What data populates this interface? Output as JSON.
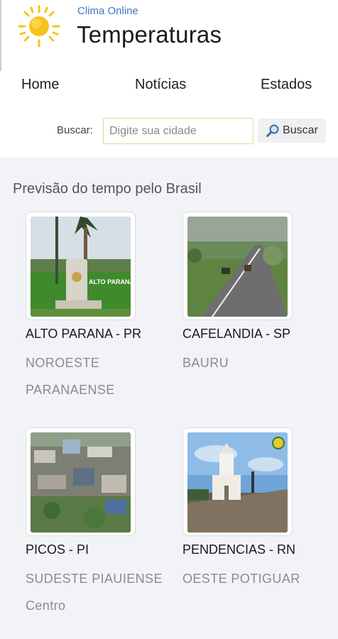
{
  "header": {
    "subtitle": "Clima Online",
    "title": "Temperaturas",
    "logo_icon": "sun-icon",
    "accent_color": "#f5c518"
  },
  "nav": {
    "items": [
      {
        "label": "Home"
      },
      {
        "label": "Notícias"
      },
      {
        "label": "Estados"
      }
    ]
  },
  "search": {
    "label": "Buscar:",
    "placeholder": "Digite sua cidade",
    "button_label": "Buscar",
    "button_icon": "search-icon"
  },
  "main": {
    "section_title": "Previsão do tempo pelo Brasil",
    "cities": [
      {
        "name": "ALTO PARANA - PR",
        "region": "NOROESTE PARANAENSE"
      },
      {
        "name": "CAFELANDIA - SP",
        "region": "BAURU"
      },
      {
        "name": "PICOS - PI",
        "region": "SUDESTE PIAUIENSE Centro"
      },
      {
        "name": "PENDENCIAS - RN",
        "region": "OESTE POTIGUAR"
      }
    ]
  }
}
